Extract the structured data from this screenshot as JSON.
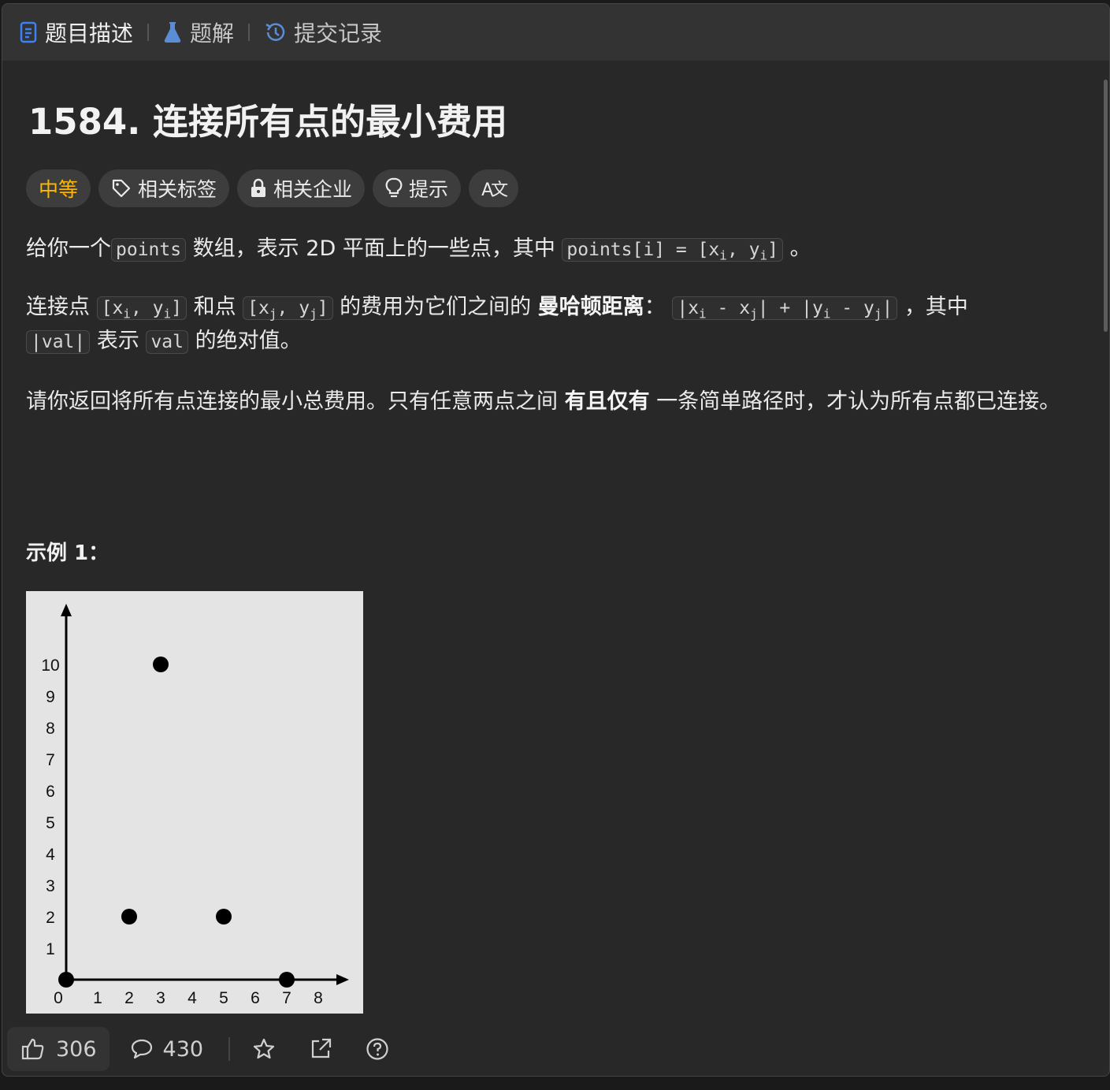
{
  "tabs": [
    {
      "label": "题目描述",
      "icon": "doc-icon"
    },
    {
      "label": "题解",
      "icon": "flask-icon"
    },
    {
      "label": "提交记录",
      "icon": "history-icon"
    }
  ],
  "title": "1584. 连接所有点的最小费用",
  "chips": {
    "difficulty": "中等",
    "tags": "相关标签",
    "companies": "相关企业",
    "hint": "提示",
    "translate": "A文"
  },
  "desc": {
    "p1_a": "给你一个",
    "p1_code1": "points",
    "p1_b": "数组，表示 2D 平面上的一些点，其中",
    "p1_code2_a": "points[i] = [x",
    "p1_code2_sub1": "i",
    "p1_code2_b": ", y",
    "p1_code2_sub2": "i",
    "p1_code2_c": "]",
    "p1_c": "。",
    "p2_a": "连接点",
    "p2_code1_a": "[x",
    "p2_code1_sub1": "i",
    "p2_code1_b": ", y",
    "p2_code1_sub2": "i",
    "p2_code1_c": "]",
    "p2_b": "和点",
    "p2_code2_a": "[x",
    "p2_code2_sub1": "j",
    "p2_code2_b": ", y",
    "p2_code2_sub2": "j",
    "p2_code2_c": "]",
    "p2_c": "的费用为它们之间的",
    "p2_bold": "曼哈顿距离",
    "p2_d": "：",
    "p2_code3_a": "|x",
    "p2_code3_sub1": "i",
    "p2_code3_b": " - x",
    "p2_code3_sub2": "j",
    "p2_code3_c": "| + |y",
    "p2_code3_sub3": "i",
    "p2_code3_d": " - y",
    "p2_code3_sub4": "j",
    "p2_code3_e": "|",
    "p2_e": "，其中",
    "p2_code4": "|val|",
    "p2_f": "表示",
    "p2_code5": "val",
    "p2_g": "的绝对值。",
    "p3_a": "请你返回将所有点连接的最小总费用。只有任意两点之间",
    "p3_bold": "有且仅有",
    "p3_b": "一条简单路径时，才认为所有点都已连接。"
  },
  "example_title": "示例 1：",
  "chart_data": {
    "type": "scatter",
    "title": "",
    "xlabel": "",
    "ylabel": "",
    "x_ticks": [
      "0",
      "1",
      "2",
      "3",
      "4",
      "5",
      "6",
      "7",
      "8"
    ],
    "y_ticks": [
      "1",
      "2",
      "3",
      "4",
      "5",
      "6",
      "7",
      "8",
      "9",
      "10"
    ],
    "xlim": [
      0,
      8
    ],
    "ylim": [
      0,
      10
    ],
    "points": [
      {
        "x": 0,
        "y": 0
      },
      {
        "x": 2,
        "y": 2
      },
      {
        "x": 3,
        "y": 10
      },
      {
        "x": 5,
        "y": 2
      },
      {
        "x": 7,
        "y": 0
      }
    ],
    "grid": false
  },
  "footer": {
    "likes": "306",
    "comments": "430"
  },
  "colors": {
    "accent": "#ffb800",
    "panel_bg": "#282828",
    "tab_bg": "#333333",
    "active_tab_icon": "#3b82f6"
  }
}
